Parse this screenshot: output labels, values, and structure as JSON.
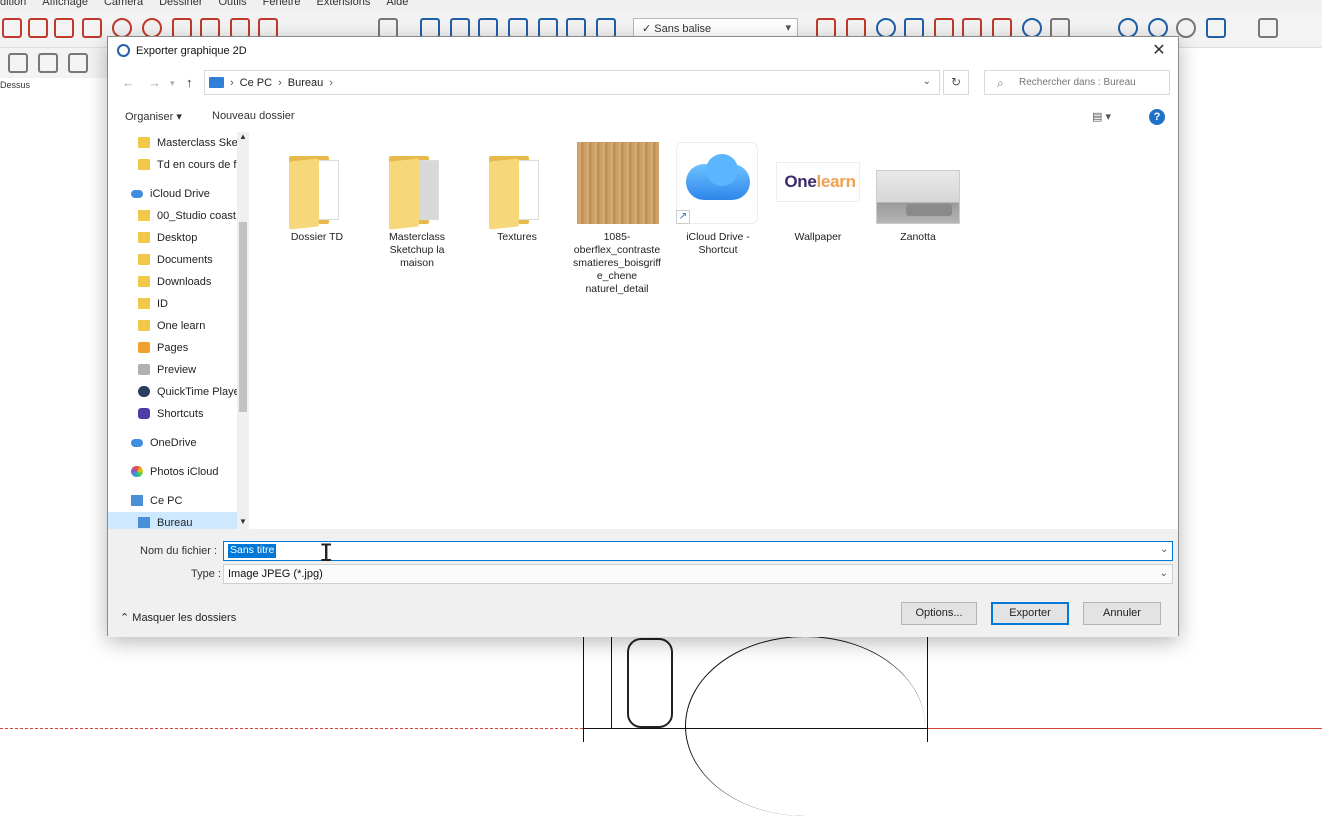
{
  "app": {
    "menu": [
      "dition",
      "Affichage",
      "Caméra",
      "Dessiner",
      "Outils",
      "Fenêtre",
      "Extensions",
      "Aide"
    ],
    "scene_select": "Sans balise",
    "view_label": "Dessus"
  },
  "dialog": {
    "title": "Exporter graphique 2D",
    "close": "✕",
    "address": {
      "crumbs": [
        "Ce PC",
        "Bureau"
      ],
      "sep": "›"
    },
    "search_placeholder": "Rechercher dans : Bureau",
    "organize": "Organiser ▾",
    "new_folder": "Nouveau dossier",
    "help": "?",
    "sidebar": [
      {
        "label": "Masterclass Sket",
        "icon": "folder"
      },
      {
        "label": "Td en cours de fi",
        "icon": "folder"
      },
      {
        "label": "iCloud Drive",
        "icon": "cloud"
      },
      {
        "label": "00_Studio coast",
        "icon": "folder"
      },
      {
        "label": "Desktop",
        "icon": "folder"
      },
      {
        "label": "Documents",
        "icon": "folder"
      },
      {
        "label": "Downloads",
        "icon": "folder"
      },
      {
        "label": "ID",
        "icon": "folder"
      },
      {
        "label": "One learn",
        "icon": "folder"
      },
      {
        "label": "Pages",
        "icon": "pages"
      },
      {
        "label": "Preview",
        "icon": "app"
      },
      {
        "label": "QuickTime Playe",
        "icon": "quicktime"
      },
      {
        "label": "Shortcuts",
        "icon": "shortcuts"
      },
      {
        "label": "OneDrive",
        "icon": "cloud"
      },
      {
        "label": "Photos iCloud",
        "icon": "photos"
      },
      {
        "label": "Ce PC",
        "icon": "pc"
      },
      {
        "label": "Bureau",
        "icon": "pc"
      }
    ],
    "files": [
      {
        "label": "Dossier TD",
        "type": "folder"
      },
      {
        "label": "Masterclass Sketchup la maison",
        "type": "folder"
      },
      {
        "label": "Textures",
        "type": "folder"
      },
      {
        "label": "1085-oberflex_contrastesmatieres_boisgriffe_chene naturel_detail",
        "type": "image"
      },
      {
        "label": "iCloud Drive - Shortcut",
        "type": "shortcut"
      },
      {
        "label": "Wallpaper",
        "type": "image"
      },
      {
        "label": "Zanotta",
        "type": "image"
      }
    ],
    "wallpaper_logo": {
      "main": "One",
      "accent": "learn"
    },
    "filename_label": "Nom du fichier :",
    "filename_value": "Sans titre",
    "type_label": "Type :",
    "type_value": "Image JPEG (*.jpg)",
    "hide_folders": "Masquer les dossiers",
    "buttons": {
      "options": "Options...",
      "export": "Exporter",
      "cancel": "Annuler"
    }
  }
}
